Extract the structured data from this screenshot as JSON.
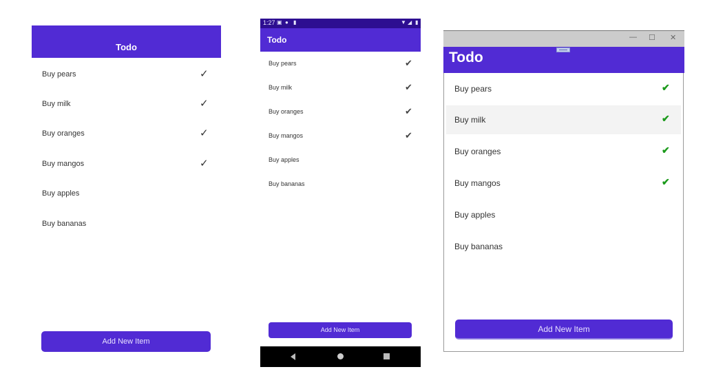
{
  "panels": [
    {
      "platform": "web",
      "title": "Todo",
      "items": [
        {
          "label": "Buy pears",
          "done": true
        },
        {
          "label": "Buy milk",
          "done": true
        },
        {
          "label": "Buy oranges",
          "done": true
        },
        {
          "label": "Buy mangos",
          "done": true
        },
        {
          "label": "Buy apples",
          "done": false
        },
        {
          "label": "Buy bananas",
          "done": false
        }
      ],
      "add_button": "Add New Item",
      "check_glyph": "✓"
    },
    {
      "platform": "android",
      "status_bar": {
        "time": "1:27",
        "left_icons": [
          "notification-icon",
          "app-icon",
          "sd-card-icon"
        ],
        "right_icons": [
          "wifi-icon",
          "signal-icon",
          "battery-icon"
        ]
      },
      "title": "Todo",
      "items": [
        {
          "label": "Buy pears",
          "done": true
        },
        {
          "label": "Buy milk",
          "done": true
        },
        {
          "label": "Buy oranges",
          "done": true
        },
        {
          "label": "Buy mangos",
          "done": true
        },
        {
          "label": "Buy apples",
          "done": false
        },
        {
          "label": "Buy bananas",
          "done": false
        }
      ],
      "add_button": "Add New Item",
      "check_glyph": "✔"
    },
    {
      "platform": "windows",
      "window_controls": {
        "minimize": "—",
        "maximize": "☐",
        "close": "✕"
      },
      "title": "Todo",
      "highlighted_item": 1,
      "items": [
        {
          "label": "Buy pears",
          "done": true
        },
        {
          "label": "Buy milk",
          "done": true
        },
        {
          "label": "Buy oranges",
          "done": true
        },
        {
          "label": "Buy mangos",
          "done": true
        },
        {
          "label": "Buy apples",
          "done": false
        },
        {
          "label": "Buy bananas",
          "done": false
        }
      ],
      "add_button": "Add New Item",
      "check_glyph": "✔",
      "check_color": "#1b9a1b"
    }
  ],
  "colors": {
    "brand": "#512bd4",
    "android_status": "#2d0e91"
  }
}
